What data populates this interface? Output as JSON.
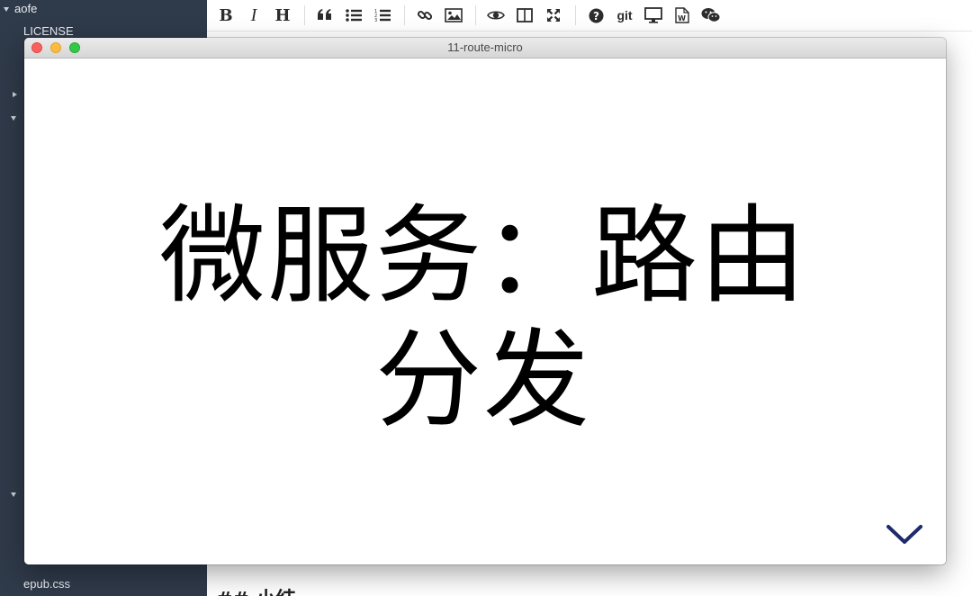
{
  "sidebar": {
    "root_label": "aofe",
    "items": [
      {
        "label": "LICENSE"
      },
      {
        "label": "epub.css"
      }
    ]
  },
  "toolbar": {
    "git_label": "git",
    "buttons": [
      "bold",
      "italic",
      "heading",
      "quote",
      "unordered-list",
      "ordered-list",
      "link",
      "image",
      "preview",
      "side-by-side",
      "fullscreen",
      "help",
      "git",
      "presentation",
      "word-export",
      "wechat"
    ],
    "bold_glyph": "B",
    "italic_glyph": "I",
    "heading_glyph": "H"
  },
  "editor": {
    "bottom_text": "## 小结"
  },
  "preview_window": {
    "title": "11-route-micro",
    "slide_title": "微服务：路由分发"
  },
  "colors": {
    "sidebar_bg": "#2f3a4a",
    "nav_arrow": "#1f2a6b",
    "close": "#fc605c",
    "minimize": "#fdbc40",
    "maximize": "#34c84a"
  }
}
